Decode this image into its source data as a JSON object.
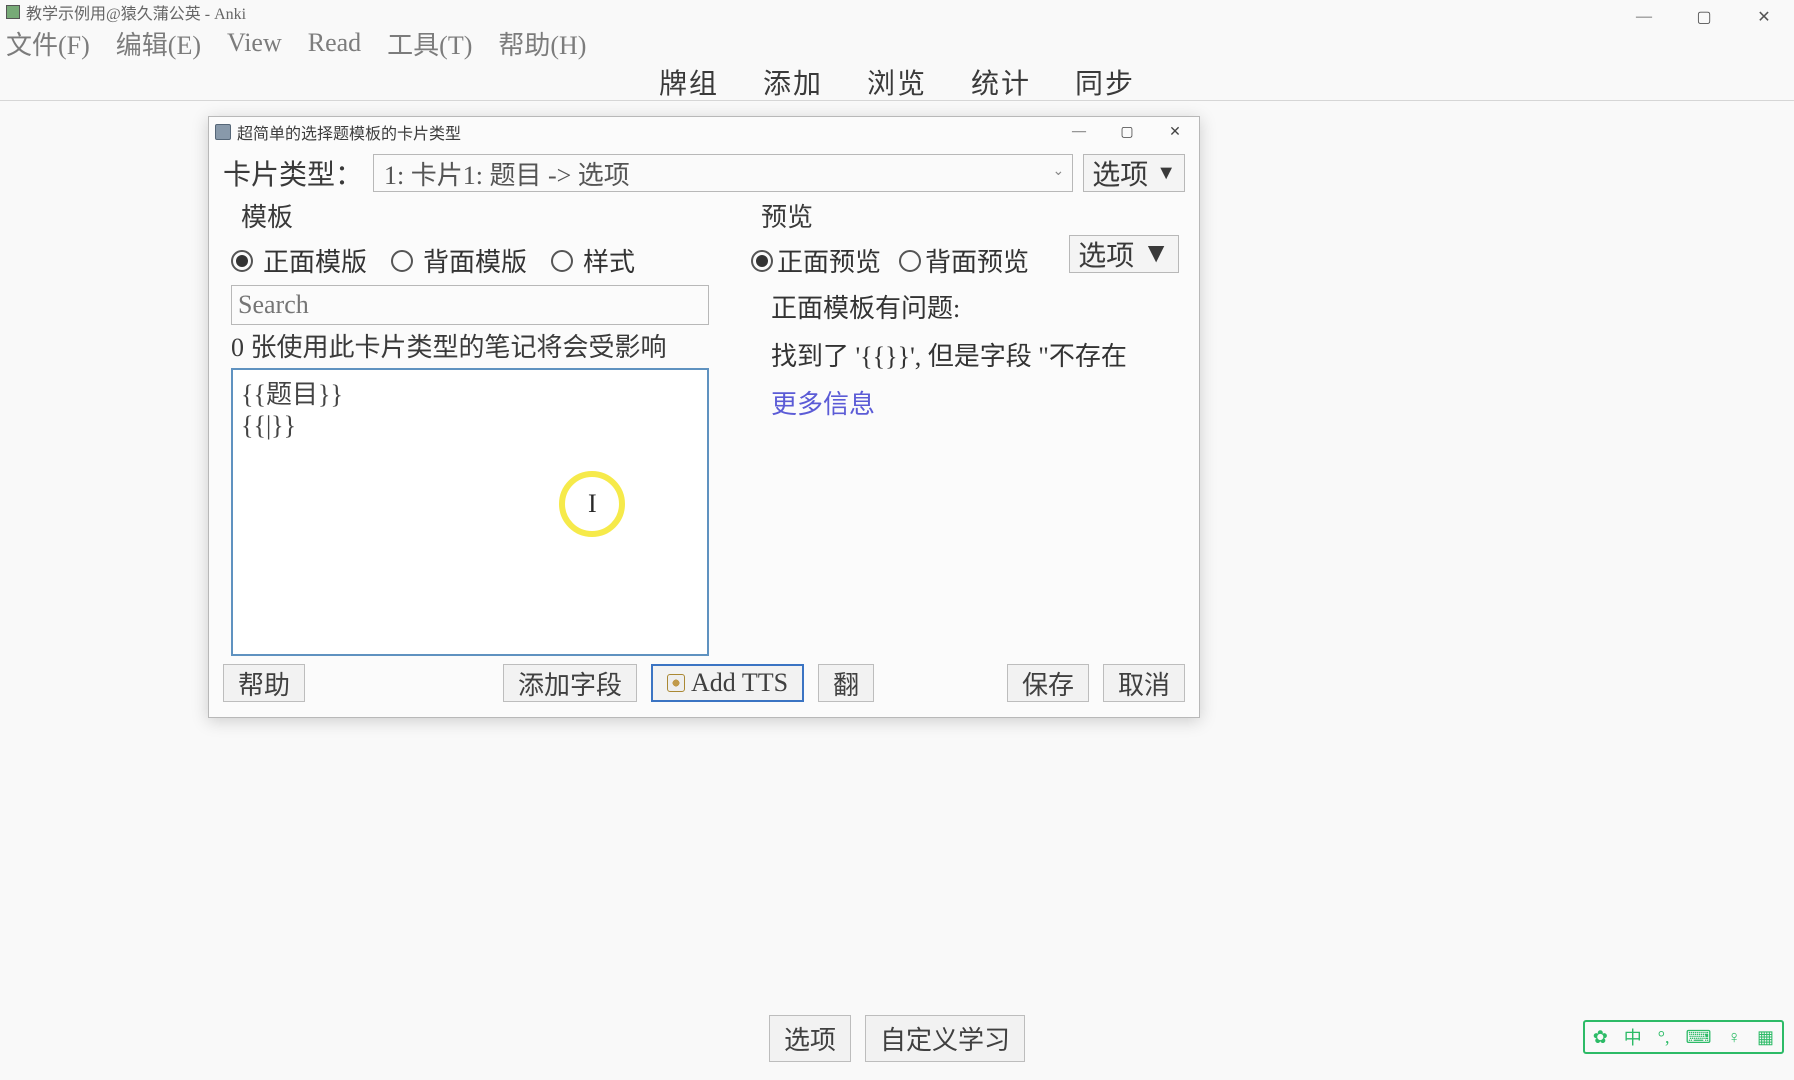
{
  "main_window": {
    "title": "教学示例用@猿久蒲公英 - Anki",
    "menu": {
      "file": "文件(F)",
      "edit": "编辑(E)",
      "view": "View",
      "read": "Read",
      "tools": "工具(T)",
      "help": "帮助(H)"
    },
    "tabs": {
      "decks": "牌组",
      "add": "添加",
      "browse": "浏览",
      "stats": "统计",
      "sync": "同步"
    },
    "bottom": {
      "options": "选项",
      "customStudy": "自定义学习"
    }
  },
  "dialog": {
    "title": "超简单的选择题模板的卡片类型",
    "cardtype_label": "卡片类型：",
    "cardtype_value": "1: 卡片1: 题目 -> 选项",
    "options_btn": "选项",
    "left": {
      "group": "模板",
      "radio_front": "正面模版",
      "radio_back": "背面模版",
      "radio_style": "样式",
      "search_placeholder": "Search",
      "info_line": "0 张使用此卡片类型的笔记将会受影响",
      "code": "{{题目}}\n{{|}}"
    },
    "right": {
      "group": "预览",
      "radio_front": "正面预览",
      "radio_back": "背面预览",
      "options_btn": "选项",
      "msg_line1": "正面模板有问题:",
      "msg_line2": "找到了 '{{}}', 但是字段 \"不存在",
      "more_link": "更多信息"
    },
    "footer": {
      "help": "帮助",
      "addfield": "添加字段",
      "addtts": "Add TTS",
      "fan": "翻",
      "save": "保存",
      "cancel": "取消"
    }
  },
  "ime": {
    "lang": "中",
    "punct": "°,",
    "items": [
      "⌨",
      "♀",
      "⌗"
    ]
  }
}
